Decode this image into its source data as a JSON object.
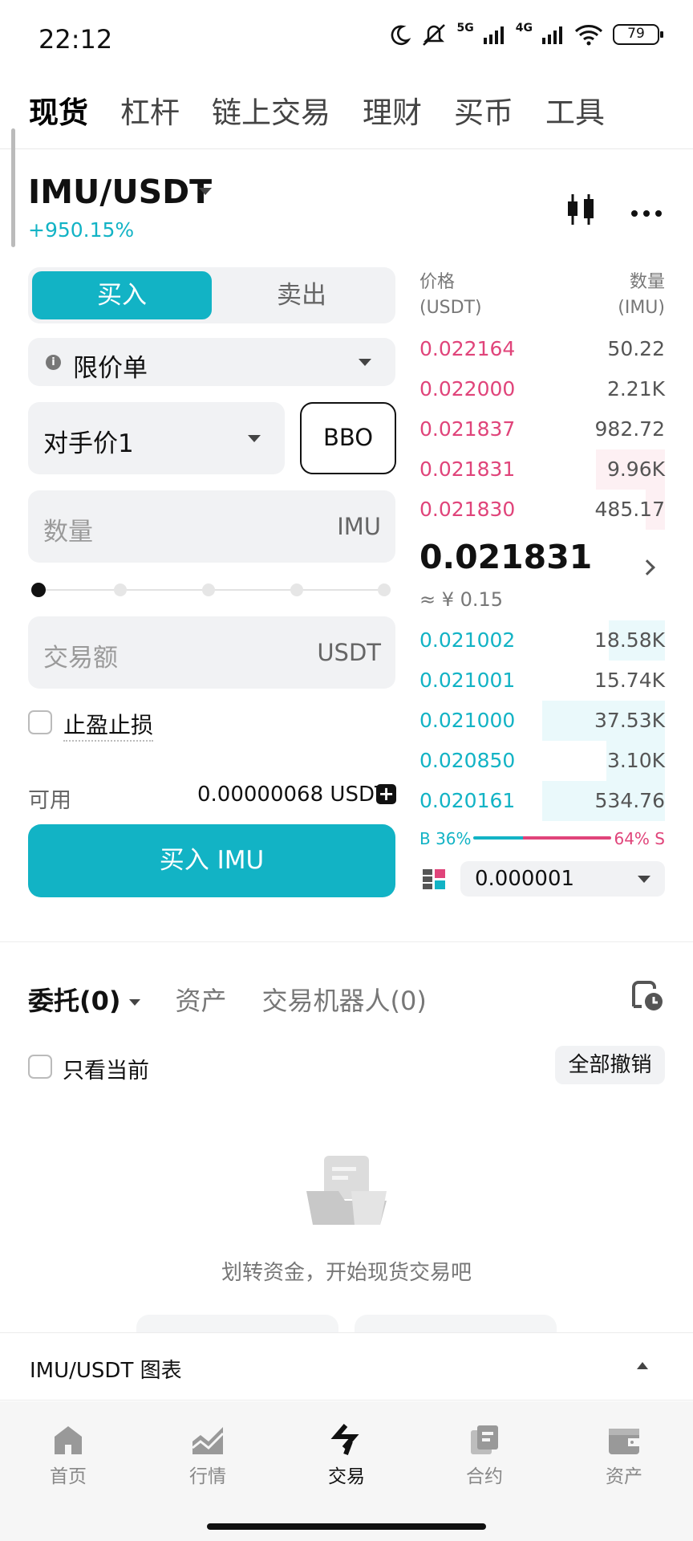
{
  "status_bar": {
    "time": "22:12",
    "network1": "5G",
    "network2": "4G",
    "battery": "79"
  },
  "top_tabs": [
    "现货",
    "杠杆",
    "链上交易",
    "理财",
    "买币",
    "工具"
  ],
  "pair": {
    "symbol": "IMU/USDT",
    "change": "+950.15%"
  },
  "trade_form": {
    "buy_tab": "买入",
    "sell_tab": "卖出",
    "order_type": "限价单",
    "price_mode": "对手价1",
    "bbo": "BBO",
    "qty_placeholder": "数量",
    "qty_unit": "IMU",
    "slider_percent": 0,
    "amount_placeholder": "交易额",
    "amount_unit": "USDT",
    "tpsl_label": "止盈止损",
    "available_label": "可用",
    "available_value": "0.00000068 USDT",
    "buy_button": "买入 IMU"
  },
  "orderbook": {
    "price_header": "价格",
    "price_unit": "(USDT)",
    "qty_header": "数量",
    "qty_unit": "(IMU)",
    "asks": [
      {
        "price": "0.022164",
        "qty": "50.22",
        "depth": 0.0
      },
      {
        "price": "0.022000",
        "qty": "2.21K",
        "depth": 0.0
      },
      {
        "price": "0.021837",
        "qty": "982.72",
        "depth": 0.0
      },
      {
        "price": "0.021831",
        "qty": "9.96K",
        "depth": 0.28
      },
      {
        "price": "0.021830",
        "qty": "485.17",
        "depth": 0.08
      }
    ],
    "last_price": "0.021831",
    "fiat_price": "≈ ¥ 0.15",
    "bids": [
      {
        "price": "0.021002",
        "qty": "18.58K",
        "depth": 0.23
      },
      {
        "price": "0.021001",
        "qty": "15.74K",
        "depth": 0.0
      },
      {
        "price": "0.021000",
        "qty": "37.53K",
        "depth": 0.5
      },
      {
        "price": "0.020850",
        "qty": "3.10K",
        "depth": 0.24
      },
      {
        "price": "0.020161",
        "qty": "534.76",
        "depth": 0.5
      }
    ],
    "buy_ratio": "B 36%",
    "sell_ratio": "64% S",
    "buy_ratio_value": 36,
    "depth_step": "0.000001"
  },
  "orders": {
    "tabs": [
      "委托(0)",
      "资产",
      "交易机器人(0)"
    ],
    "only_current": "只看当前",
    "cancel_all": "全部撤销",
    "empty_text": "划转资金，开始现货交易吧"
  },
  "chart_bar": {
    "label": "IMU/USDT 图表"
  },
  "bottom_nav": [
    "首页",
    "行情",
    "交易",
    "合约",
    "资产"
  ],
  "colors": {
    "accent": "#12b3c5",
    "sell": "#e0447a"
  }
}
